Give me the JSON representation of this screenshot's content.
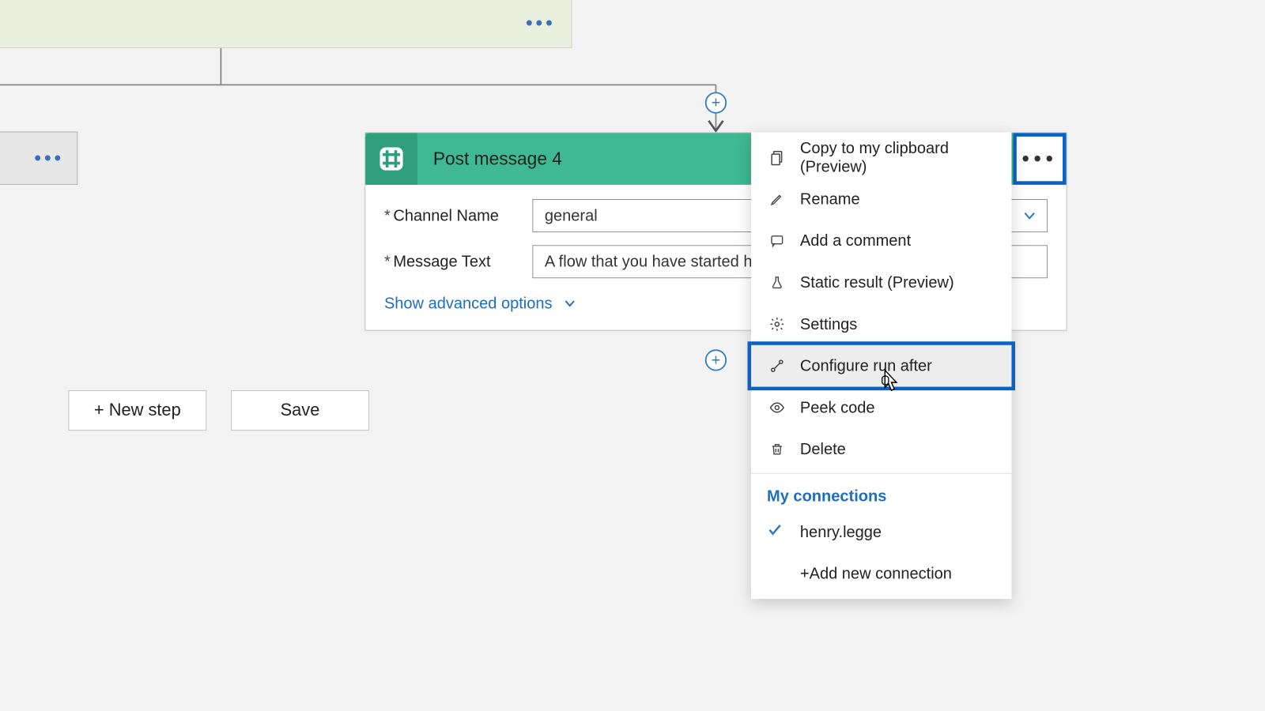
{
  "action": {
    "title": "Post message 4",
    "fields": {
      "channel": {
        "label": "Channel Name",
        "value": "general"
      },
      "message": {
        "label": "Message Text",
        "value": "A flow that you have started has"
      }
    },
    "advanced": "Show advanced options"
  },
  "buttons": {
    "new_step": "+ New step",
    "save": "Save"
  },
  "menu": {
    "copy": "Copy to my clipboard (Preview)",
    "rename": "Rename",
    "comment": "Add a comment",
    "static_result": "Static result (Preview)",
    "settings": "Settings",
    "run_after": "Configure run after",
    "peek_code": "Peek code",
    "delete": "Delete",
    "connections_header": "My connections",
    "connection_name": "henry.legge",
    "add_connection": "+Add new connection"
  }
}
